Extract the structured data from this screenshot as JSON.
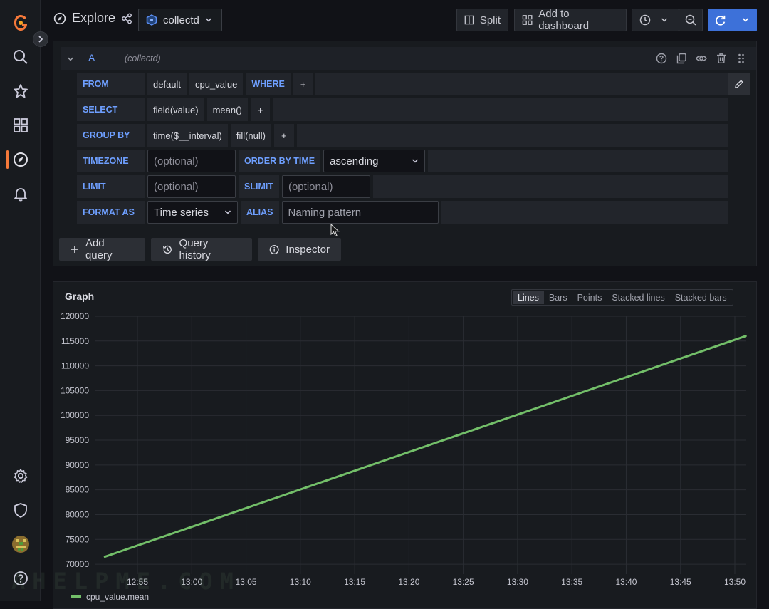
{
  "topbar": {
    "title": "Explore",
    "datasource": "collectd",
    "split_label": "Split",
    "add_to_dashboard_label": "Add to dashboard"
  },
  "query": {
    "ref_id": "A",
    "datasource_hint": "(collectd)",
    "from_label": "FROM",
    "from_policy": "default",
    "from_measurement": "cpu_value",
    "where_label": "WHERE",
    "plus": "+",
    "select_label": "SELECT",
    "select_field": "field(value)",
    "select_agg": "mean()",
    "groupby_label": "GROUP BY",
    "groupby_time": "time($__interval)",
    "groupby_fill": "fill(null)",
    "timezone_label": "TIMEZONE",
    "timezone_placeholder": "(optional)",
    "orderby_label": "ORDER BY TIME",
    "orderby_value": "ascending",
    "limit_label": "LIMIT",
    "limit_placeholder": "(optional)",
    "slimit_label": "SLIMIT",
    "slimit_placeholder": "(optional)",
    "formatas_label": "FORMAT AS",
    "formatas_value": "Time series",
    "alias_label": "ALIAS",
    "alias_placeholder": "Naming pattern"
  },
  "actions": {
    "add_query": "Add query",
    "query_history": "Query history",
    "inspector": "Inspector"
  },
  "graph": {
    "title": "Graph",
    "modes": [
      "Lines",
      "Bars",
      "Points",
      "Stacked lines",
      "Stacked bars"
    ],
    "active_mode": "Lines"
  },
  "watermark": "AHELPME.COM",
  "colors": {
    "series": "#73bf69",
    "accent": "#3d71d9",
    "active": "#f5793a"
  },
  "chart_data": {
    "type": "line",
    "title": "Graph",
    "xlabel": "",
    "ylabel": "",
    "x_ticks": [
      "12:55",
      "13:00",
      "13:05",
      "13:10",
      "13:15",
      "13:20",
      "13:25",
      "13:30",
      "13:35",
      "13:40",
      "13:45",
      "13:50"
    ],
    "y_ticks": [
      70000,
      75000,
      80000,
      85000,
      90000,
      95000,
      100000,
      105000,
      110000,
      115000,
      120000
    ],
    "ylim": [
      68000,
      120000
    ],
    "grid": true,
    "legend_position": "bottom-left",
    "series": [
      {
        "name": "cpu_value.mean",
        "color": "#73bf69",
        "x": [
          "12:52",
          "13:51"
        ],
        "values": [
          71500,
          116000
        ]
      }
    ]
  }
}
